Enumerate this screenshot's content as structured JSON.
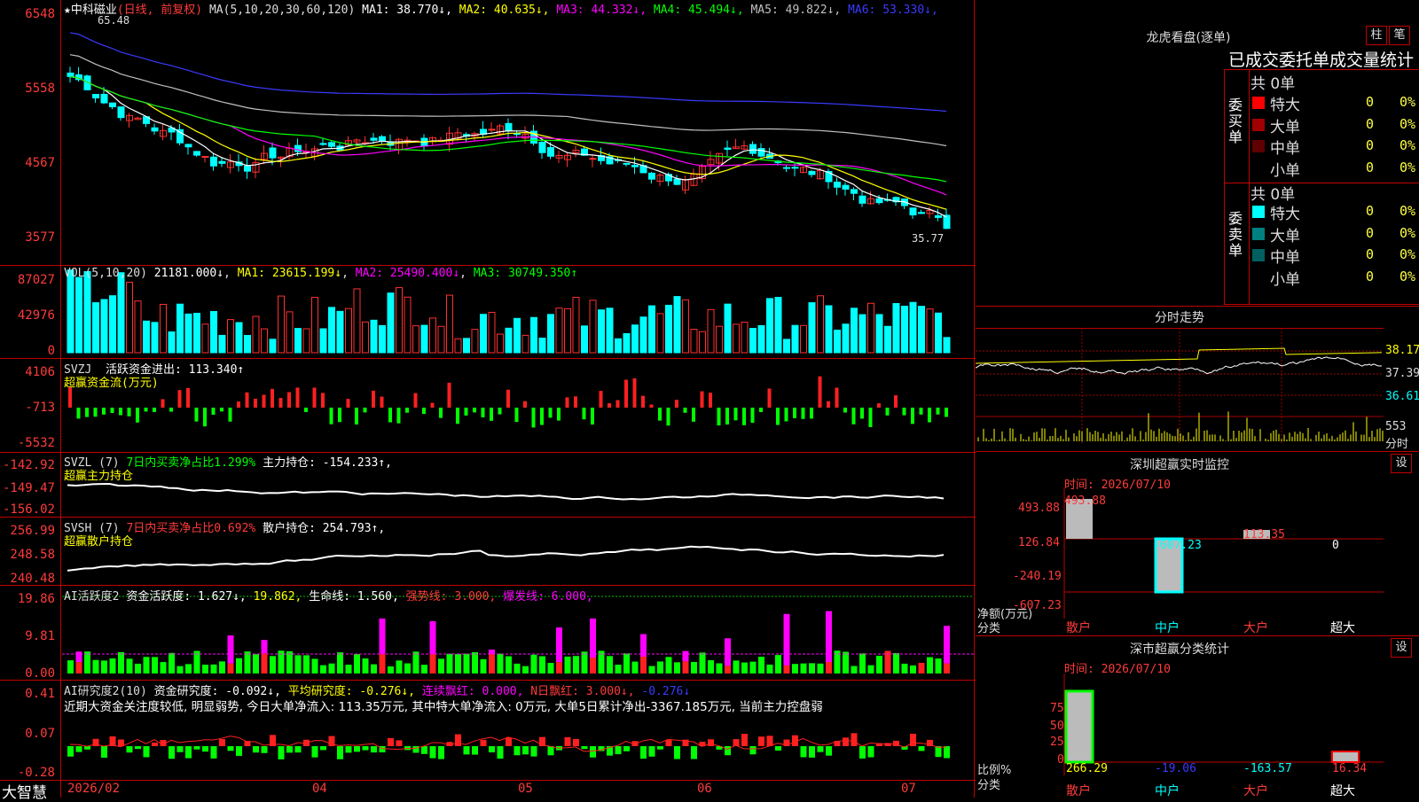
{
  "price_panel": {
    "stock": "★中科磁业",
    "mode": "(日线, 前复权)",
    "ma_label": "MA(5,10,20,30,60,120)",
    "ma": [
      {
        "name": "MA1",
        "value": "38.770↓",
        "color": "#ffffff"
      },
      {
        "name": "MA2",
        "value": "40.635↓",
        "color": "#ffff00"
      },
      {
        "name": "MA3",
        "value": "44.332↓",
        "color": "#ff00ff"
      },
      {
        "name": "MA4",
        "value": "45.494↓",
        "color": "#00ff00"
      },
      {
        "name": "MA5",
        "value": "49.822↓",
        "color": "#c0c0c0"
      },
      {
        "name": "MA6",
        "value": "53.330↓",
        "color": "#3a3aff"
      }
    ],
    "y_ticks": [
      "6548",
      "5558",
      "4567",
      "3577"
    ],
    "high_label": "65.48",
    "low_label": "35.77"
  },
  "vol_panel": {
    "label": "VOL(5,10,20)",
    "vol": "21181.000↓",
    "ma1": "MA1: 23615.199↓",
    "ma2": "MA2: 25490.400↓",
    "ma3": "MA3: 30749.350↑",
    "y_ticks": [
      "87027",
      "42976",
      "0"
    ]
  },
  "svzj_panel": {
    "label": "SVZJ",
    "text": "活跃资金进出: 113.340↑",
    "sub": "超赢资金流(万元)",
    "y_ticks": [
      "4106",
      "-713",
      "-5532"
    ]
  },
  "svzl_panel": {
    "label": "SVZL (7)",
    "text1": "7日内买卖净占比1.299%",
    "text2": "主力持仓: -154.233↑,",
    "sub": "超赢主力持仓",
    "y_ticks": [
      "-142.92",
      "-149.47",
      "-156.02"
    ]
  },
  "svsh_panel": {
    "label": "SVSH (7)",
    "text1": "7日内买卖净占比0.692%",
    "text2": "散户持仓: 254.793↑,",
    "sub": "超赢散户持仓",
    "y_ticks": [
      "256.99",
      "248.58",
      "240.48"
    ]
  },
  "ai_panel": {
    "label": "AI活跃度2",
    "text1": "资金活跃度: 1.627↓,",
    "text2": "19.862,",
    "text3": "生命线: 1.560,",
    "text4": "强势线: 3.000,",
    "text5": "爆发线: 6.000,",
    "y_ticks": [
      "19.86",
      "9.81",
      "0.00"
    ]
  },
  "air_panel": {
    "label": "AI研究度2(10)",
    "text1": "资金研究度: -0.092↓,",
    "text2": "平均研究度: -0.276↓,",
    "text3": "连续飘红: 0.000,",
    "text4": "N日飘红: 3.000↓,",
    "text5": "-0.276↓",
    "comment": "近期大资金关注度较低, 明显弱势, 今日大单净流入: 113.35万元, 其中特大单净流入: 0万元, 大单5日累计净出-3367.185万元, 当前主力控盘弱",
    "y_ticks": [
      "0.41",
      "0.07",
      "-0.28"
    ]
  },
  "x_axis": {
    "brand": "大智慧",
    "labels": [
      "2026/02",
      "04",
      "05",
      "06",
      "07"
    ]
  },
  "dragon": {
    "title": "龙虎看盘(逐单)",
    "btn1": "柱",
    "btn2": "笔",
    "tab_header": "已成交委托单成交量统计",
    "buy_group": "委买单",
    "sell_group": "委卖单",
    "buy_total": "共 0单",
    "sell_total": "共 0单",
    "buy_rows": [
      {
        "label": "特大",
        "val": "0",
        "pct": "0%",
        "color": "#ff0000"
      },
      {
        "label": "大单",
        "val": "0",
        "pct": "0%",
        "color": "#a00000"
      },
      {
        "label": "中单",
        "val": "0",
        "pct": "0%",
        "color": "#600000"
      },
      {
        "label": "小单",
        "val": "0",
        "pct": "0%",
        "color": ""
      }
    ],
    "sell_rows": [
      {
        "label": "特大",
        "val": "0",
        "pct": "0%",
        "color": "#00ffff"
      },
      {
        "label": "大单",
        "val": "0",
        "pct": "0%",
        "color": "#008080"
      },
      {
        "label": "中单",
        "val": "0",
        "pct": "0%",
        "color": "#006060"
      },
      {
        "label": "小单",
        "val": "0",
        "pct": "0%",
        "color": ""
      }
    ]
  },
  "intraday": {
    "title": "分时走势",
    "price_ticks": [
      "38.17",
      "37.39",
      "36.61"
    ],
    "vol_tick": "553",
    "vol_label": "分时"
  },
  "sz_monitor": {
    "title": "深圳超赢实时监控",
    "set": "设",
    "time": "时间: 2026/07/10",
    "y_ticks": [
      "493.88",
      "126.84",
      "-240.19",
      "-607.23"
    ],
    "bar_values": [
      "493.88",
      "-607.23",
      "113.35",
      "0"
    ],
    "y_title1": "净额(万元)",
    "y_title2": "分类",
    "cats": [
      "散户",
      "中户",
      "大户",
      "超大"
    ]
  },
  "sz_class": {
    "title": "深市超赢分类统计",
    "set": "设",
    "time": "时间: 2026/07/10",
    "y_ticks": [
      "75",
      "50",
      "25",
      "0"
    ],
    "bar_values": [
      "266.29",
      "-19.06",
      "-163.57",
      "16.34"
    ],
    "y_title1": "比例%",
    "y_title2": "分类",
    "cats": [
      "散户",
      "中户",
      "大户",
      "超大"
    ]
  }
}
